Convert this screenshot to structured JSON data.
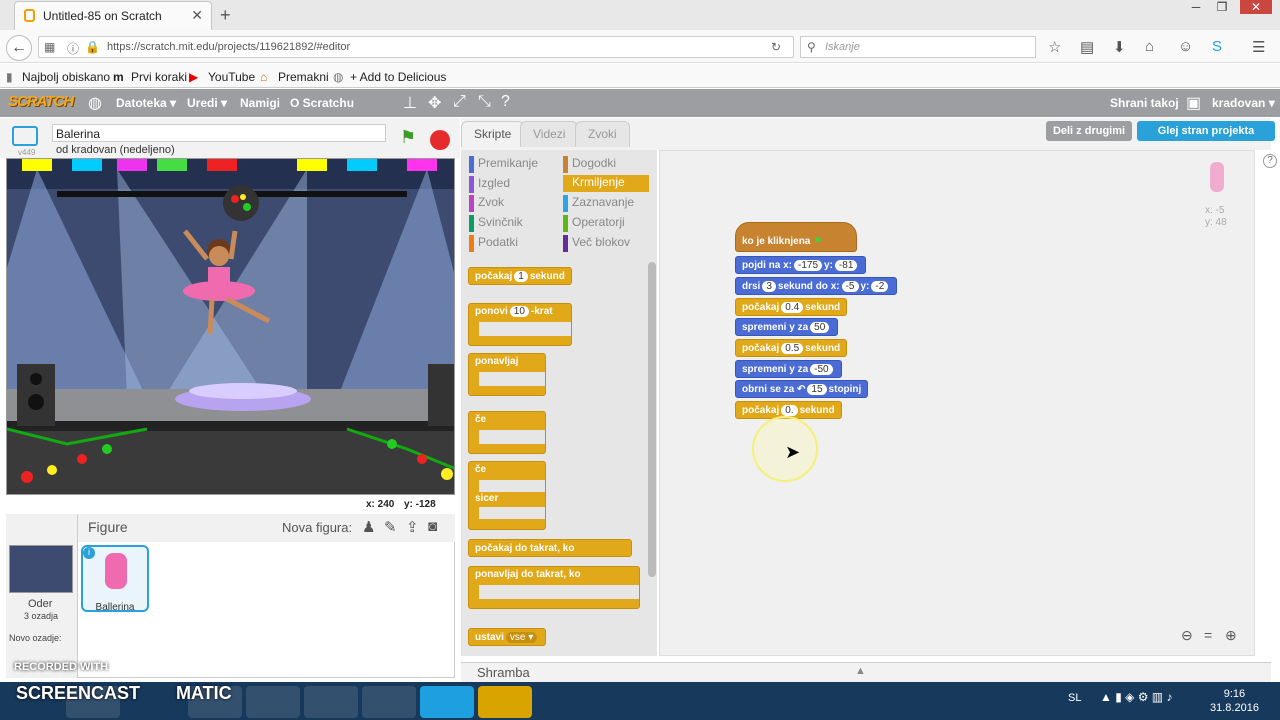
{
  "browser": {
    "tab_title": "Untitled-85 on Scratch",
    "url": "https://scratch.mit.edu/projects/119621892/#editor",
    "search_placeholder": "Iskanje",
    "bookmarks": [
      "Najbolj obiskano",
      "Prvi koraki",
      "YouTube",
      "Premakni",
      "+ Add to Delicious"
    ]
  },
  "scratch_menu": {
    "logo": "SCRATCH",
    "items": [
      "Datoteka ▾",
      "Uredi ▾",
      "Namigi",
      "O Scratchu"
    ],
    "save_now": "Shrani takoj",
    "user": "kradovan ▾"
  },
  "stage": {
    "sprite_name": "Balerina",
    "owner": "od kradovan (nedeljeno)",
    "version": "v449",
    "mouse_x": "x: 240",
    "mouse_y": "y: -128"
  },
  "sprites": {
    "header": "Figure",
    "new_sprite": "Nova figura:",
    "stage_label": "Oder",
    "backdrops": "3 ozadja",
    "new_backdrop": "Novo ozadje:",
    "sprite": "Ballerina"
  },
  "editor_tabs": [
    "Skripte",
    "Videzi",
    "Zvoki"
  ],
  "buttons": {
    "share": "Deli z drugimi",
    "see_project": "Glej stran projekta"
  },
  "categories": [
    {
      "label": "Premikanje",
      "color": "#4a6cd4"
    },
    {
      "label": "Izgled",
      "color": "#8a55d7"
    },
    {
      "label": "Zvok",
      "color": "#bb42c3"
    },
    {
      "label": "Svinčnik",
      "color": "#0e9a6c"
    },
    {
      "label": "Podatki",
      "color": "#ee7d16"
    },
    {
      "label": "Dogodki",
      "color": "#c88330"
    },
    {
      "label": "Krmiljenje",
      "color": "#e1a91a"
    },
    {
      "label": "Zaznavanje",
      "color": "#2ca5e2"
    },
    {
      "label": "Operatorji",
      "color": "#5cb712"
    },
    {
      "label": "Več blokov",
      "color": "#632d99"
    }
  ],
  "palette": {
    "wait": "počakaj",
    "wait_val": "1",
    "wait_unit": "sekund",
    "repeat": "ponovi",
    "repeat_val": "10",
    "repeat_unit": "-krat",
    "forever": "ponavljaj",
    "if": "če",
    "else": "sicer",
    "wait_until": "počakaj do takrat, ko",
    "repeat_until": "ponavljaj do takrat, ko",
    "stop": "ustavi",
    "stop_val": "vse ▾"
  },
  "script": {
    "hat": "ko je kliknjena",
    "go_to": "pojdi na x:",
    "go_x": "-175",
    "go_y_label": "y:",
    "go_y": "-81",
    "glide": "drsi",
    "glide_secs": "3",
    "glide_mid": "sekund do x:",
    "glide_x": "-5",
    "glide_y_label": "y:",
    "glide_y": "-2",
    "wait1": "počakaj",
    "wait1_val": "0.4",
    "wait_unit": "sekund",
    "change_y1": "spremeni y za",
    "change_y1_val": "50",
    "wait2": "počakaj",
    "wait2_val": "0.5",
    "change_y2": "spremeni y za",
    "change_y2_val": "-50",
    "turn": "obrni se za",
    "turn_val": "15",
    "turn_unit": "stopinj",
    "wait3": "počakaj",
    "wait3_val": "0.",
    "wait3_unit": "sekund"
  },
  "sprite_info": {
    "x": "x: -5",
    "y": "y: 48"
  },
  "backpack": "Shramba",
  "watermark": {
    "line1": "RECORDED WITH",
    "line2": "SCREENCAST",
    "line3": "MATIC"
  },
  "system": {
    "lang": "SL",
    "time": "9:16",
    "date": "31.8.2016"
  }
}
